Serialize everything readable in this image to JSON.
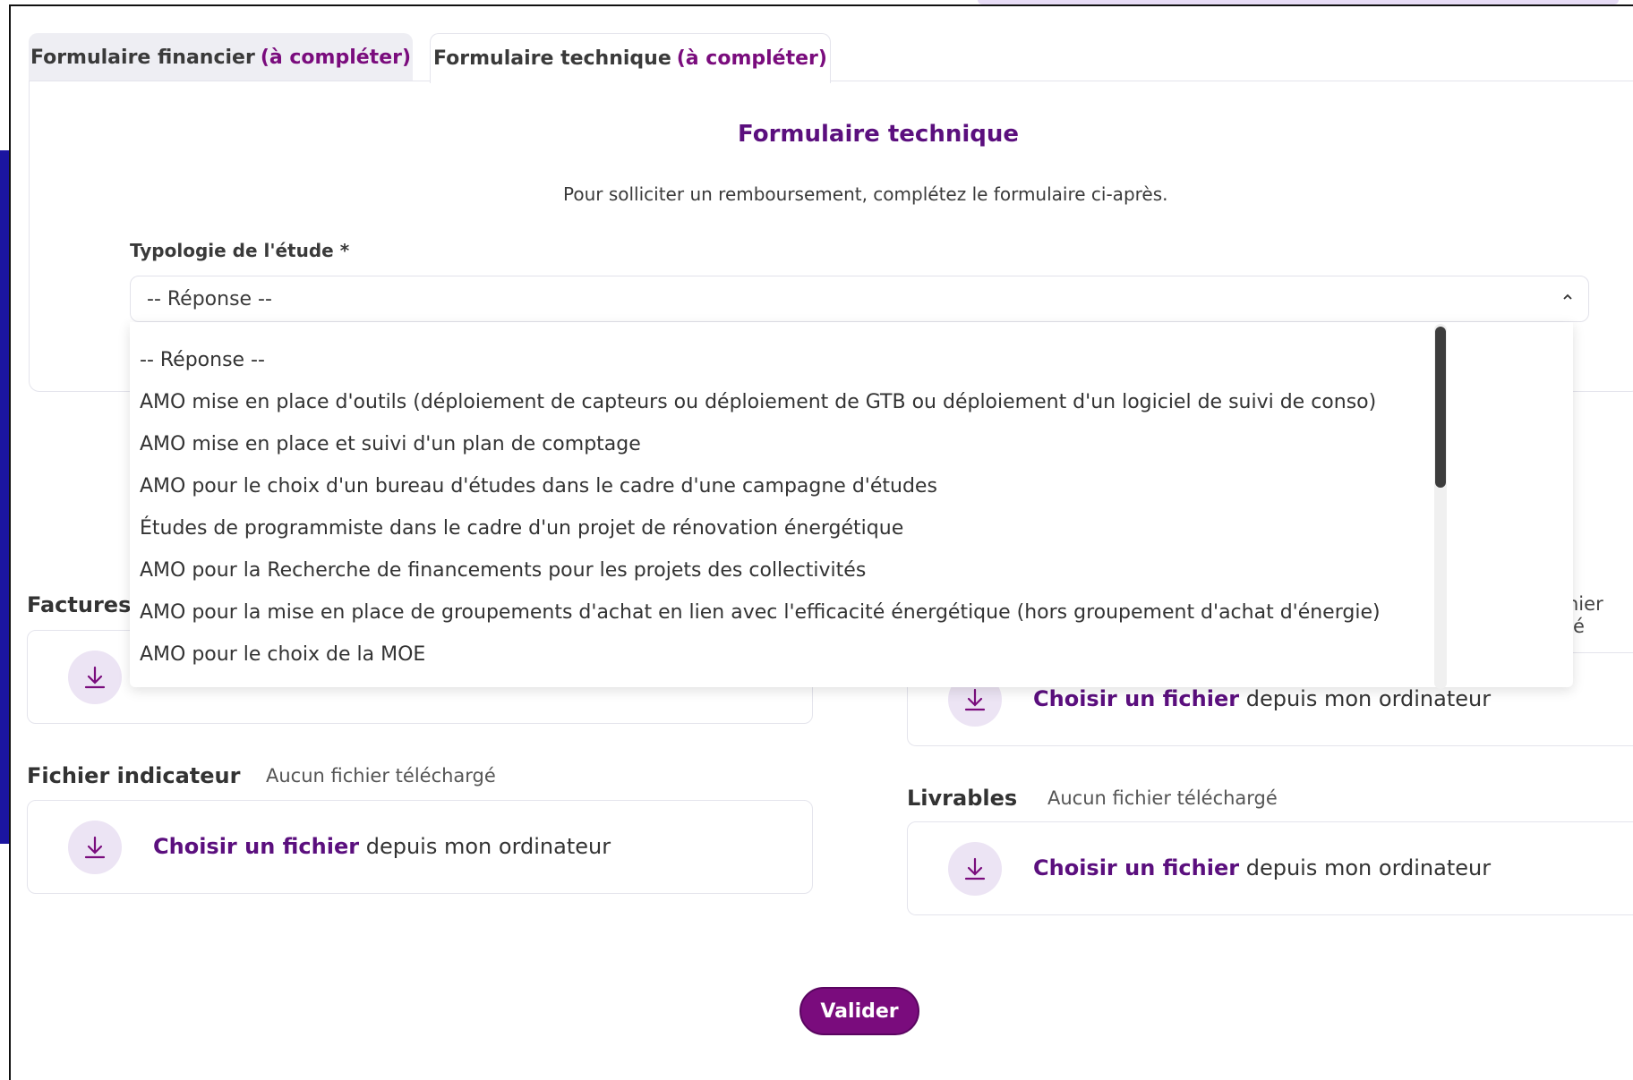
{
  "tabs": [
    {
      "label": "Formulaire financier",
      "status": "(à compléter)"
    },
    {
      "label": "Formulaire technique",
      "status": "(à compléter)"
    }
  ],
  "form": {
    "title": "Formulaire technique",
    "intro": "Pour solliciter un remboursement, complétez le formulaire ci-après.",
    "typology_label": "Typologie de l'étude *",
    "typology_selected": "-- Réponse --",
    "typology_options": [
      "-- Réponse --",
      "AMO mise en place d'outils (déploiement de capteurs ou déploiement de GTB ou déploiement d'un logiciel de suivi de conso)",
      "AMO mise en place et suivi d'un plan de comptage",
      "AMO pour le choix d'un bureau d'études dans le cadre d'une campagne d'études",
      "Études de programmiste dans le cadre d'un projet de rénovation énergétique",
      "AMO pour la Recherche de financements pour les projets des collectivités",
      "AMO pour la mise en place de groupements d'achat en lien avec l'efficacité énergétique (hors groupement d'achat d'énergie)",
      "AMO pour le choix de la MOE"
    ]
  },
  "uploads": {
    "factures": {
      "title": "Factures"
    },
    "right_top": {
      "title_fragment_1": "hier",
      "title_fragment_2": "é",
      "choose": "Choisir un fichier",
      "suffix": "depuis mon ordinateur"
    },
    "indicateur": {
      "title": "Fichier indicateur",
      "status": "Aucun fichier téléchargé",
      "choose": "Choisir un fichier",
      "suffix": "depuis mon ordinateur"
    },
    "livrables": {
      "title": "Livrables",
      "status": "Aucun fichier téléchargé",
      "choose": "Choisir un fichier",
      "suffix": "depuis mon ordinateur"
    }
  },
  "submit_label": "Valider",
  "colors": {
    "accent": "#7a0c7d",
    "title": "#5b0f7e",
    "icon_bg": "#ece4f4",
    "left_bar": "#1b15a0"
  }
}
